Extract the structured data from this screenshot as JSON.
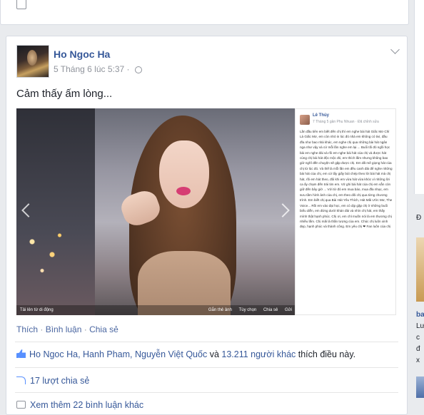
{
  "post": {
    "author": "Ho Ngoc Ha",
    "timestamp": "5 Tháng 6 lúc 5:37 ·",
    "status_text": "Cảm thấy ấm lòng...",
    "photo": {
      "caption_label": "Tải lên từ di động",
      "bar_actions": [
        "Gắn thẻ ảnh",
        "Tùy chọn",
        "Chia sẻ",
        "Gửi"
      ],
      "embedded_post": {
        "name": "Lê Thủy",
        "meta": "7 Tháng 5 gần Phu Nhuan · Đã chỉnh sửa",
        "text": "Lần đầu tiên em biết đến chị thì em nghe bài hát Giấc Mơ Chỉ Là Giấc Mơ, em còn nhỏ in lúc đó nhà em không có tivi, đầu đĩa như bao nhà khác, em nghe chị qua những bài hát ngân nga như vậy và cứ mỗi lần nghe em lại ... Buổi tối đó ngồi học bài em nghe đài và rồi em nghe bài hát của chị và được hát cùng chị bài hát độc mộc đó, em thích lắm nhưng không bao giờ nghĩ đến chuyện sẽ gặp được chị. Em đã mê giọng hát của chị từ lúc đó. Và thế là mỗi lần em đều canh đài để nghe những bài hát của chị, em cứ lẩy giấy bút chép theo lời bài hát mà chị hát, rồi em hát theo, đôi khi em vừa hát vừa khóc vì những lời ca ấy chạm đến trái tim em. Vở ghi bài hát của chị em vẫn còn giữ đến bây giờ ... Với từ đó em mua báo, mua đĩa nhạc, em sưu tầm hình ảnh của chị, em theo dõi chị qua từng chương trình. Em biết chị qua Bài Hát Yêu Thích, Hát Mãi Ước Mơ, The Voice... Rồi em vào đại học, em có dịp gặp chị ở những buổi biểu diễn, em đứng dưới khán đài và nhìn chị hát, em thấy mình thật hạnh phúc. Chị ơi, em chỉ muốn nói là em thương chị nhiều lắm. Chị mãi là thần tượng của em. Chúc chị luôn xinh đẹp, hạnh phúc và thành công. Em yêu chị ❤ Fan luôn của chị"
      }
    },
    "actions": [
      {
        "label": "Thích"
      },
      {
        "label": "Bình luận"
      },
      {
        "label": "Chia sẻ"
      }
    ],
    "action_separator": " · ",
    "likes": {
      "names": "Ho Ngoc Ha, Hanh Pham, Nguyễn Việt Quốc",
      "connector": " và ",
      "count": "13.211 người khác",
      "suffix": " thích điều này."
    },
    "shares": "17 lượt chia sẻ",
    "more_comments": "Xem thêm 22 bình luận khác"
  },
  "right_column": {
    "heading_fragment": "Đ",
    "name_fragment": "ba",
    "lines": [
      "Lư",
      "c",
      "đ",
      "x"
    ]
  },
  "colors": {
    "link": "#365899",
    "meta": "#90949c",
    "like_blue": "#5890ff",
    "page_bg": "#e9ebee"
  },
  "icons": [
    "globe-icon",
    "chevron-down-icon",
    "thumb-icon",
    "share-icon",
    "comment-icon"
  ]
}
